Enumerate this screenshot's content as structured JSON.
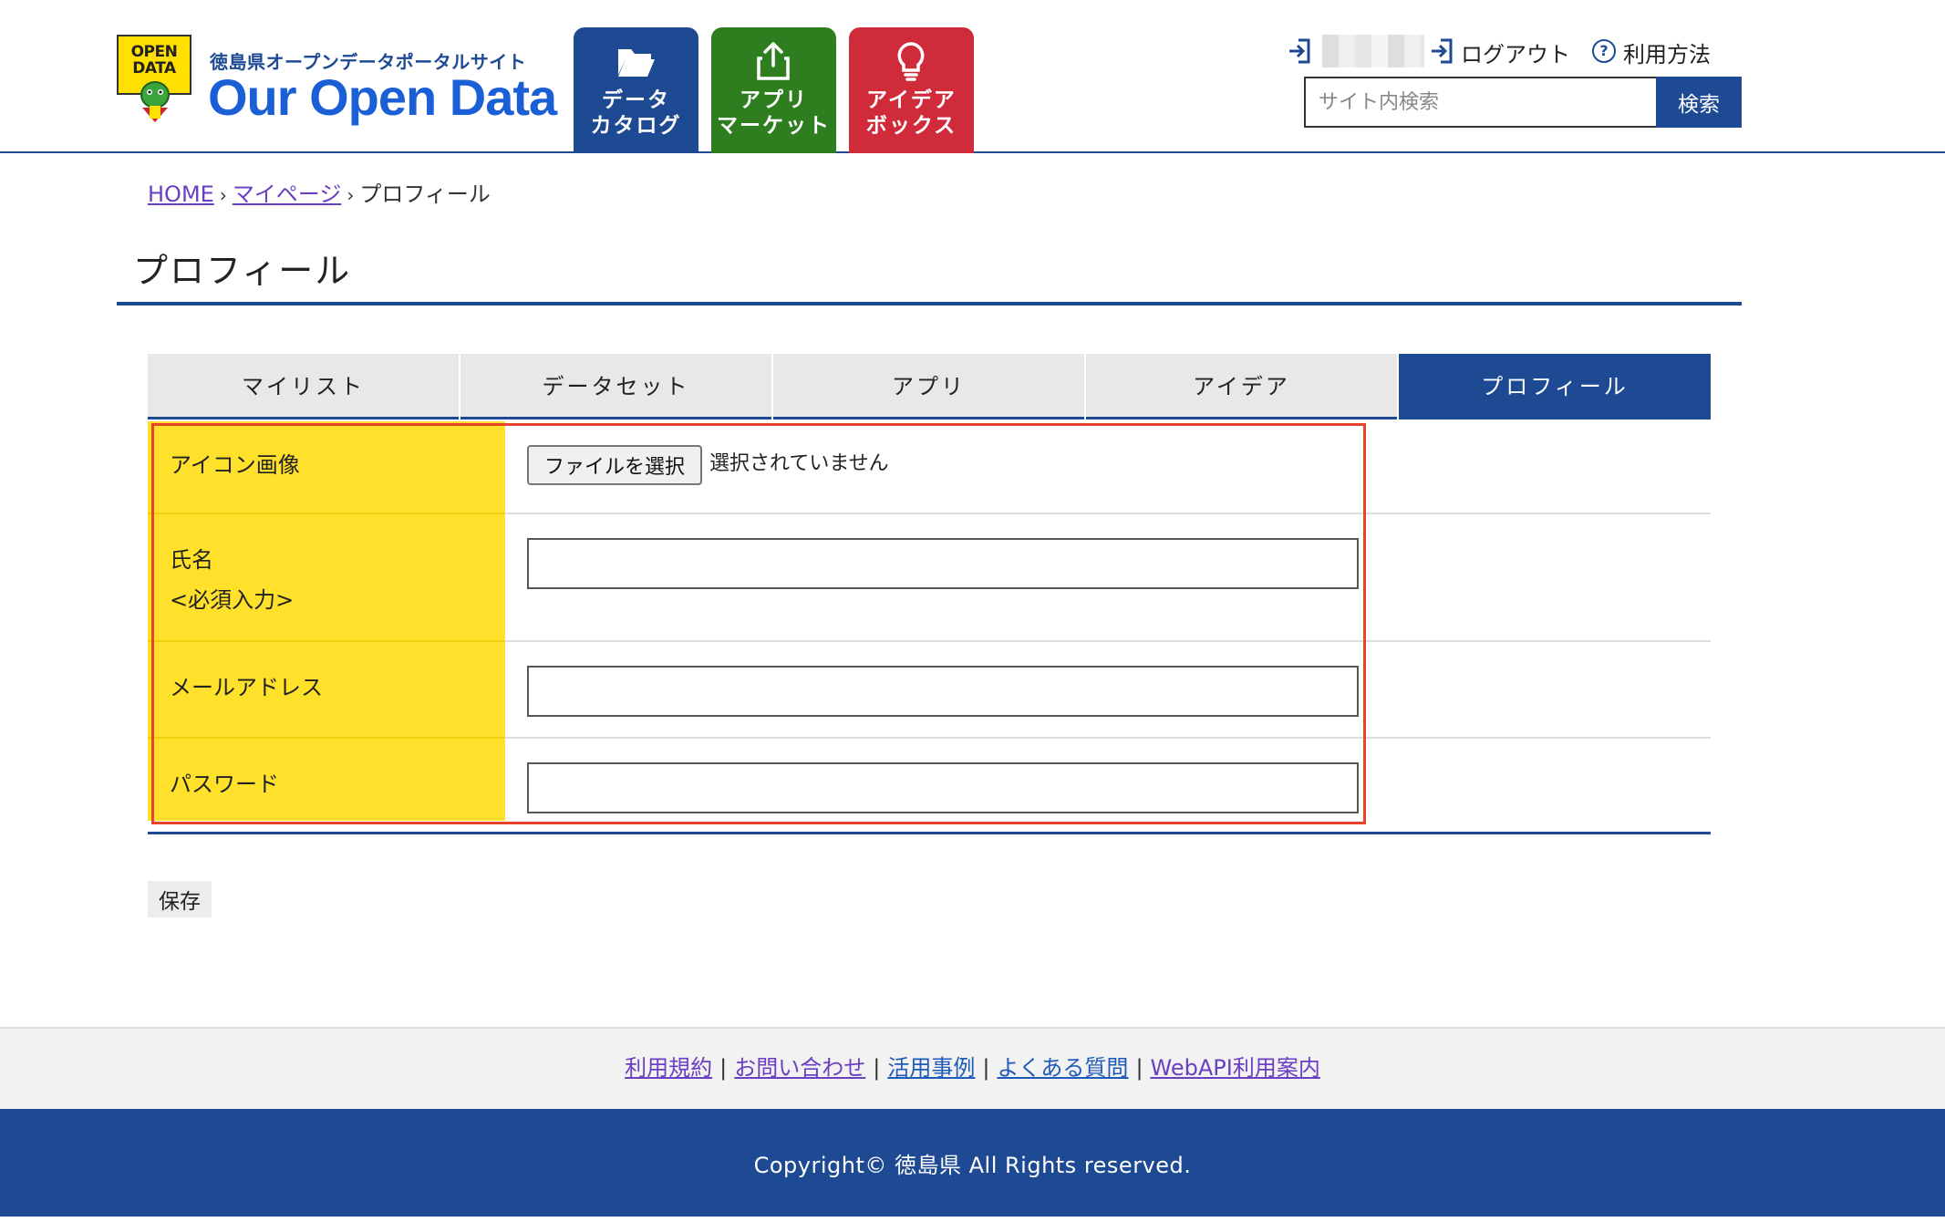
{
  "header": {
    "logo_badge": "OPEN DATA",
    "logo_subtitle": "徳島県オープンデータポータルサイト",
    "logo_title": "Our Open Data",
    "nav": [
      {
        "label_line1": "データ",
        "label_line2": "カタログ",
        "icon": "folder-open-icon",
        "color": "#1e4a94"
      },
      {
        "label_line1": "アプリ",
        "label_line2": "マーケット",
        "icon": "share-upload-icon",
        "color": "#2e7d1e"
      },
      {
        "label_line1": "アイデア",
        "label_line2": "ボックス",
        "icon": "lightbulb-icon",
        "color": "#cf2b3b"
      }
    ],
    "logout_label": "ログアウト",
    "help_label": "利用方法",
    "search": {
      "placeholder": "サイト内検索",
      "button_label": "検索"
    }
  },
  "breadcrumb": {
    "home": "HOME",
    "mypage": "マイページ",
    "current": "プロフィール",
    "separator": "›"
  },
  "page_title": "プロフィール",
  "tabs": [
    {
      "label": "マイリスト",
      "active": false
    },
    {
      "label": "データセット",
      "active": false
    },
    {
      "label": "アプリ",
      "active": false
    },
    {
      "label": "アイデア",
      "active": false
    },
    {
      "label": "プロフィール",
      "active": true
    }
  ],
  "form": {
    "icon_image": {
      "label": "アイコン画像",
      "button_label": "ファイルを選択",
      "status": "選択されていません"
    },
    "name": {
      "label": "氏名",
      "note": "<必須入力>",
      "value": ""
    },
    "email": {
      "label": "メールアドレス",
      "value": ""
    },
    "password": {
      "label": "パスワード",
      "value": ""
    }
  },
  "save_label": "保存",
  "footer": {
    "links": [
      "利用規約",
      "お問い合わせ",
      "活用事例",
      "よくある質問",
      "WebAPI利用案内"
    ],
    "copyright": "Copyright© 徳島県 All Rights reserved."
  },
  "colors": {
    "brand": "#1e4a94",
    "label_bg": "#ffe02a",
    "highlight": "#e8432b"
  }
}
